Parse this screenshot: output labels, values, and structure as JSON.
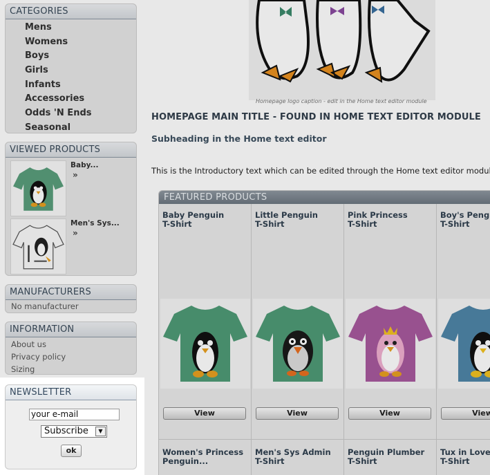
{
  "categories": {
    "title": "CATEGORIES",
    "items": [
      "Mens",
      "Womens",
      "Boys",
      "Girls",
      "Infants",
      "Accessories",
      "Odds 'N Ends",
      "Seasonal"
    ]
  },
  "viewed_products": {
    "title": "VIEWED PRODUCTS",
    "items": [
      {
        "name": "Baby...",
        "arrow": "»",
        "shirt_color": "#5a9e7c",
        "icon": "penguin-tshirt-icon"
      },
      {
        "name": "Men's Sys...",
        "arrow": "»",
        "shirt_color": "#f2f2f2",
        "icon": "penguin-tshirt-icon"
      }
    ]
  },
  "manufacturers": {
    "title": "MANUFACTURERS",
    "value": "No manufacturer"
  },
  "information": {
    "title": "INFORMATION",
    "links": [
      "About us",
      "Privacy policy",
      "Sizing"
    ]
  },
  "newsletter": {
    "title": "NEWSLETTER",
    "email_value": "your e-mail",
    "select_value": "Subscribe",
    "ok_label": "ok"
  },
  "main": {
    "logo_caption": "Homepage logo caption - edit in the Home text editor module",
    "title": "HOMEPAGE MAIN TITLE - FOUND IN HOME TEXT EDITOR MODULE",
    "subheading": "Subheading in the Home text editor",
    "intro": "This is the Introductory text which can be edited through the Home text editor module"
  },
  "featured": {
    "title": "FEATURED PRODUCTS",
    "view_label": "View",
    "products": [
      {
        "line1": "Baby Penguin",
        "line2": "T-Shirt",
        "shirt_color": "#4f9a76",
        "icon": "penguin-tshirt-icon"
      },
      {
        "line1": "Little Penguin",
        "line2": "T-Shirt",
        "shirt_color": "#4f9a76",
        "icon": "penguin-tshirt-icon"
      },
      {
        "line1": "Pink Princess",
        "line2": "T-Shirt",
        "shirt_color": "#a85a9e",
        "icon": "penguin-tshirt-icon"
      },
      {
        "line1": "Boy's Penguin",
        "line2": "T-Shirt",
        "shirt_color": "#4f86a8",
        "icon": "penguin-tshirt-icon"
      }
    ],
    "second_row": [
      {
        "line1": "Women's Princess",
        "line2": "Penguin..."
      },
      {
        "line1": "Men's Sys Admin",
        "line2": "T-Shirt"
      },
      {
        "line1": "Penguin Plumber",
        "line2": "T-Shirt"
      },
      {
        "line1": "Tux in Love",
        "line2": "T-Shirt"
      }
    ]
  }
}
